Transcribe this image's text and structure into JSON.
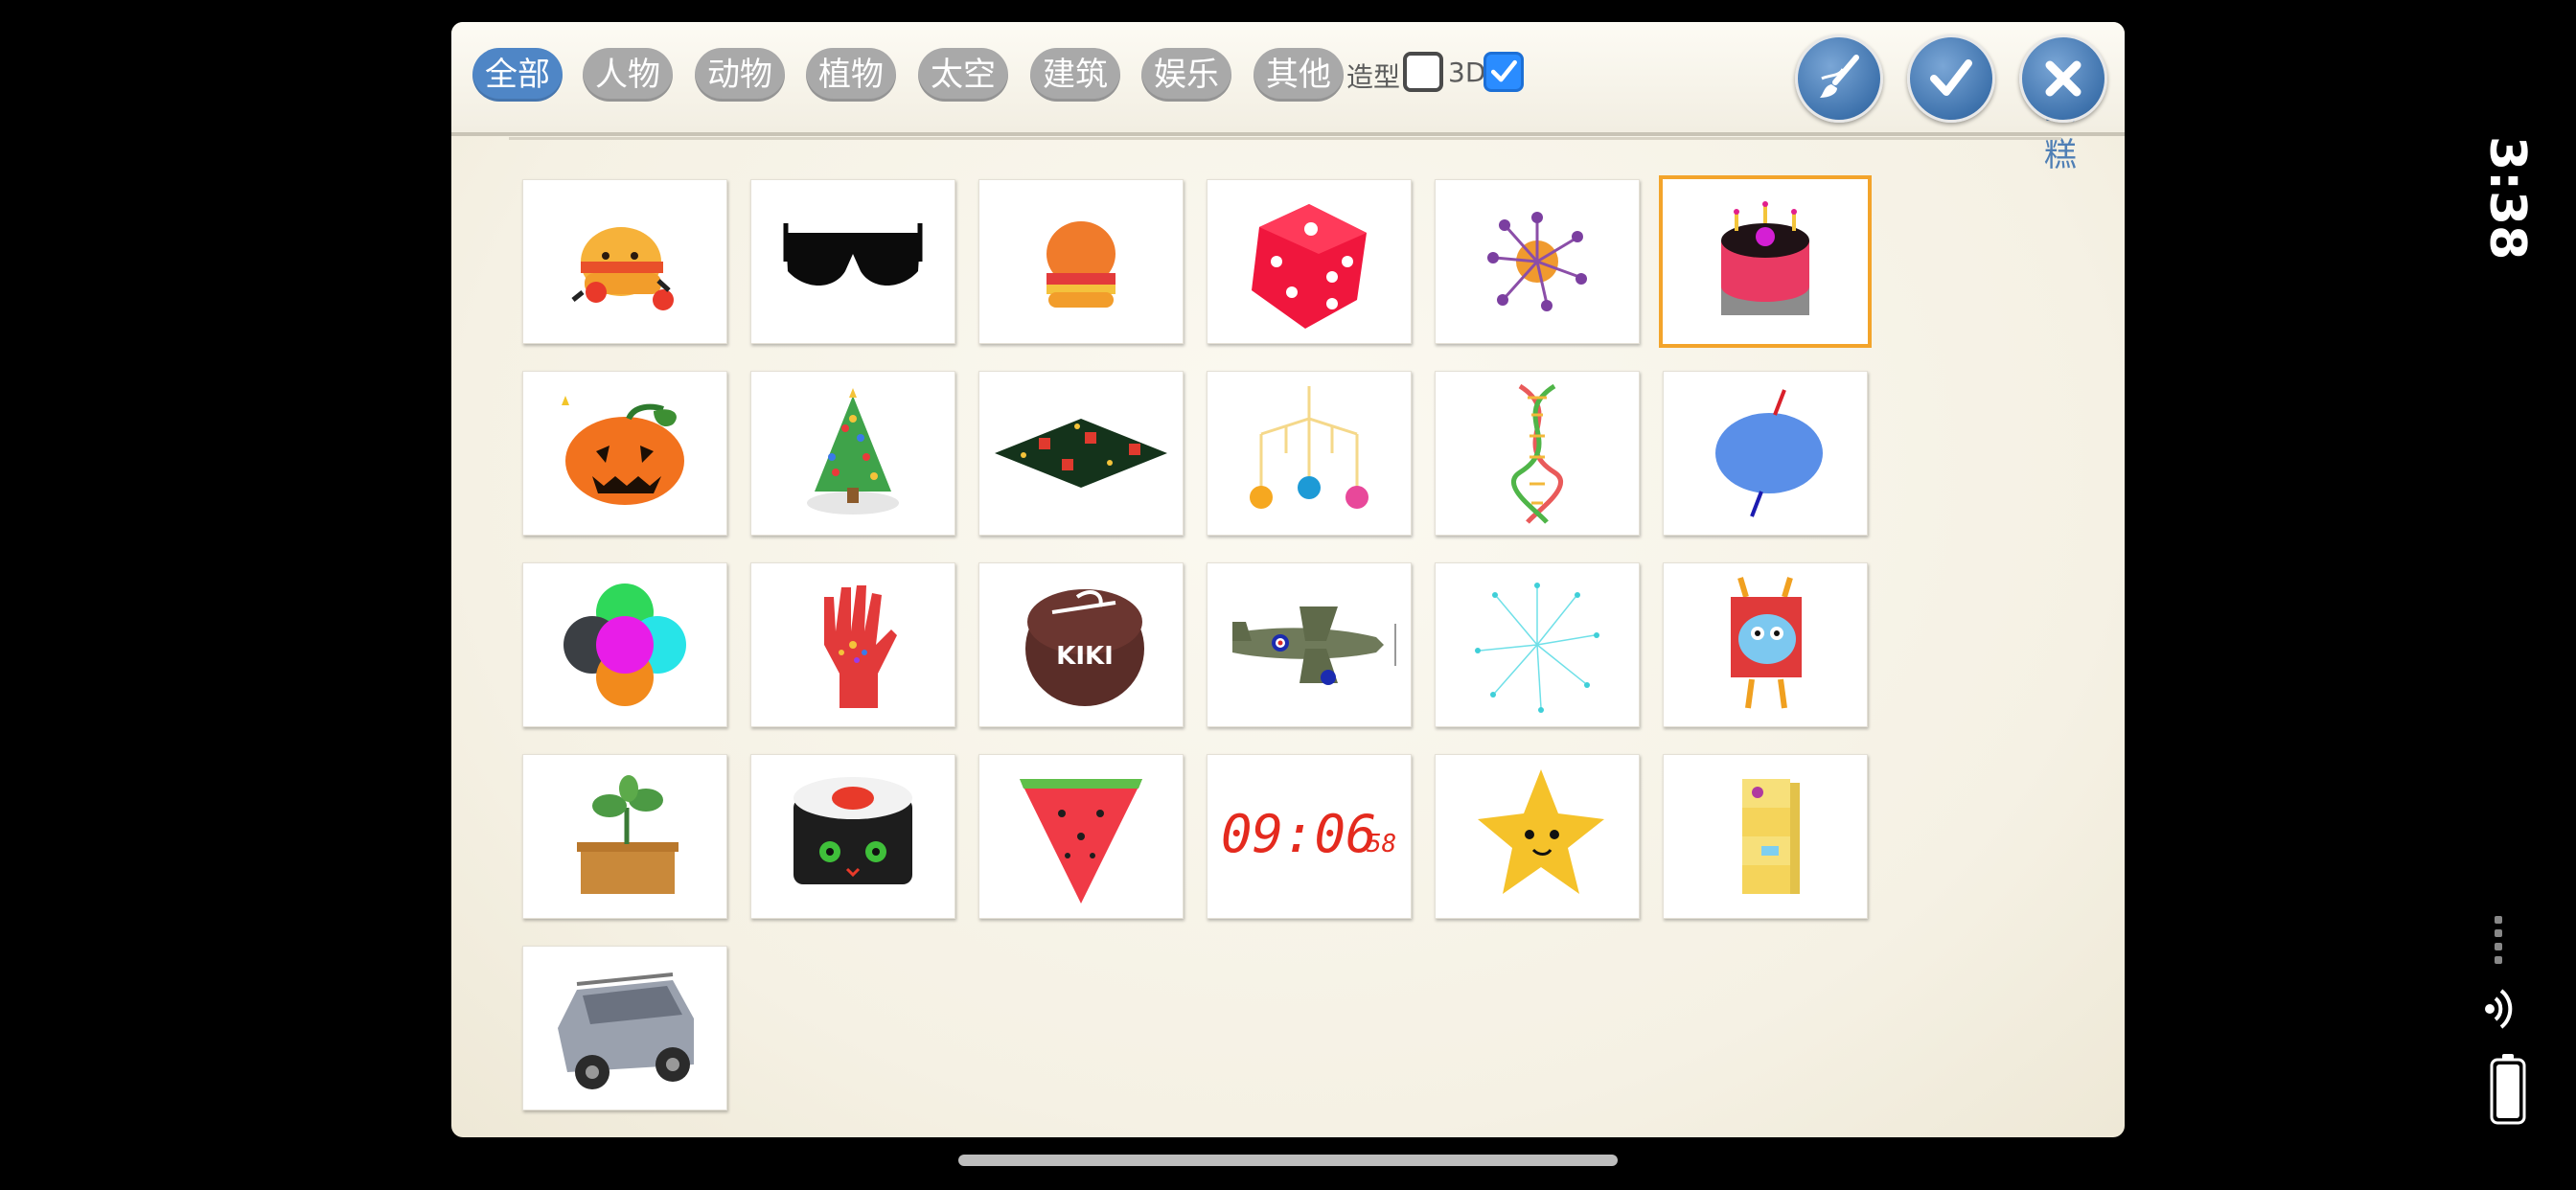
{
  "categories": [
    {
      "label": "全部",
      "active": true
    },
    {
      "label": "人物"
    },
    {
      "label": "动物"
    },
    {
      "label": "植物"
    },
    {
      "label": "太空"
    },
    {
      "label": "建筑"
    },
    {
      "label": "娱乐"
    },
    {
      "label": "其他"
    }
  ],
  "toggles": {
    "shape_label": "造型",
    "shape_checked": false,
    "threed_label": "3D",
    "threed_checked": true
  },
  "selected_name": "蛋糕",
  "buttons": {
    "paint": "paint-brush-icon",
    "confirm": "checkmark-icon",
    "close": "close-x-icon"
  },
  "items": [
    "burger-character",
    "sunglasses",
    "burger",
    "dice",
    "virus",
    "birthday-cake",
    "jack-o-lantern",
    "christmas-tree",
    "christmas-garden",
    "hanging-mobile",
    "dna-helix",
    "planet-globe",
    "color-circles",
    "robot-hand",
    "kiki-cake",
    "spitfire-plane",
    "fireworks",
    "square-monster",
    "potted-sprout",
    "sushi-cat",
    "watermelon-slice",
    "digital-clock",
    "star-face",
    "block-tower",
    "jeep"
  ],
  "clock": {
    "hhmm": "09:06",
    "ss": "58"
  },
  "cake_text": "KIKI",
  "status": {
    "time": "3:38"
  },
  "colors": {
    "accent": "#4f86c6",
    "selected_border": "#f3a42b",
    "category_bg": "#a9a9a9"
  }
}
